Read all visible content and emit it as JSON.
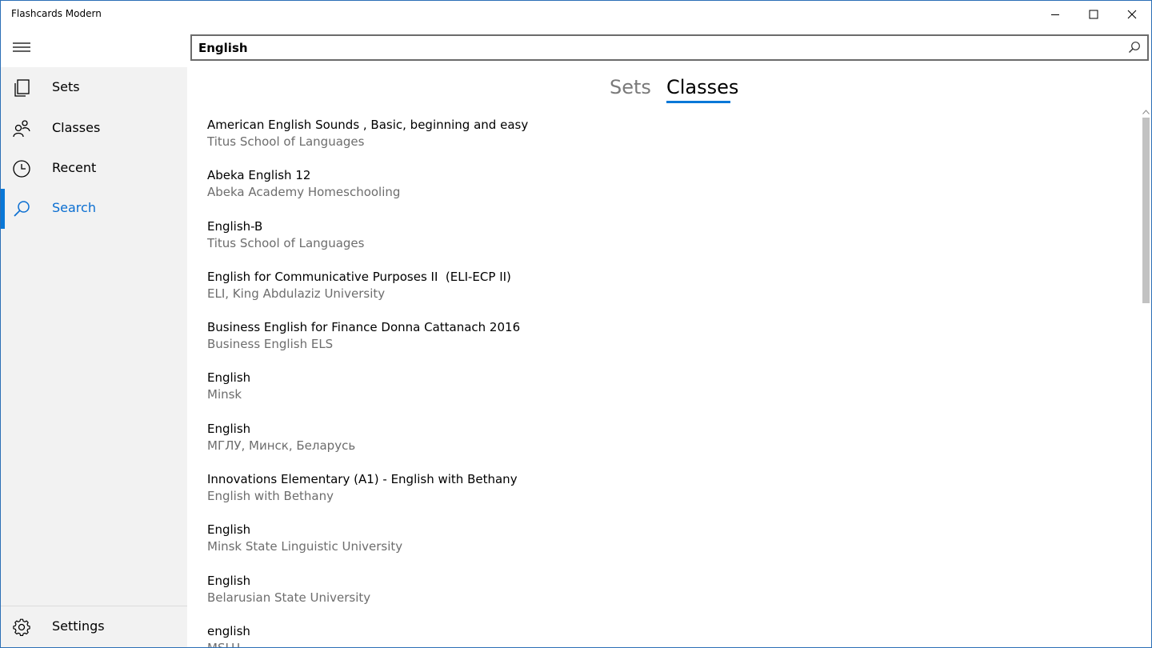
{
  "window": {
    "title": "Flashcards Modern"
  },
  "sidebar": {
    "items": [
      {
        "label": "Sets",
        "icon": "sets-icon"
      },
      {
        "label": "Classes",
        "icon": "classes-icon"
      },
      {
        "label": "Recent",
        "icon": "clock-icon"
      },
      {
        "label": "Search",
        "icon": "search-icon",
        "active": true
      }
    ],
    "settings": {
      "label": "Settings",
      "icon": "gear-icon"
    }
  },
  "search": {
    "value": "English"
  },
  "pivot": {
    "tabs": [
      {
        "label": "Sets",
        "selected": false
      },
      {
        "label": "Classes",
        "selected": true
      }
    ]
  },
  "results": [
    {
      "title": "American English Sounds , Basic, beginning and easy",
      "subtitle": "Titus School of Languages"
    },
    {
      "title": "Abeka English 12",
      "subtitle": "Abeka Academy Homeschooling"
    },
    {
      "title": "English-B",
      "subtitle": "Titus School of Languages"
    },
    {
      "title": "English for Communicative Purposes II  (ELI-ECP II)",
      "subtitle": "ELI, King Abdulaziz University"
    },
    {
      "title": "Business English for Finance Donna Cattanach 2016",
      "subtitle": "Business English ELS"
    },
    {
      "title": "English",
      "subtitle": "Minsk"
    },
    {
      "title": "English",
      "subtitle": "МГЛУ, Минск, Беларусь"
    },
    {
      "title": "Innovations Elementary (A1) - English with Bethany",
      "subtitle": "English with Bethany"
    },
    {
      "title": "English",
      "subtitle": "Minsk State Linguistic University"
    },
    {
      "title": "English",
      "subtitle": "Belarusian State University"
    },
    {
      "title": "english",
      "subtitle": "MSLU"
    }
  ],
  "colors": {
    "accent": "#0a78d7",
    "sidebar_bg": "#f2f2f2",
    "secondary_text": "#6d6d6d"
  }
}
